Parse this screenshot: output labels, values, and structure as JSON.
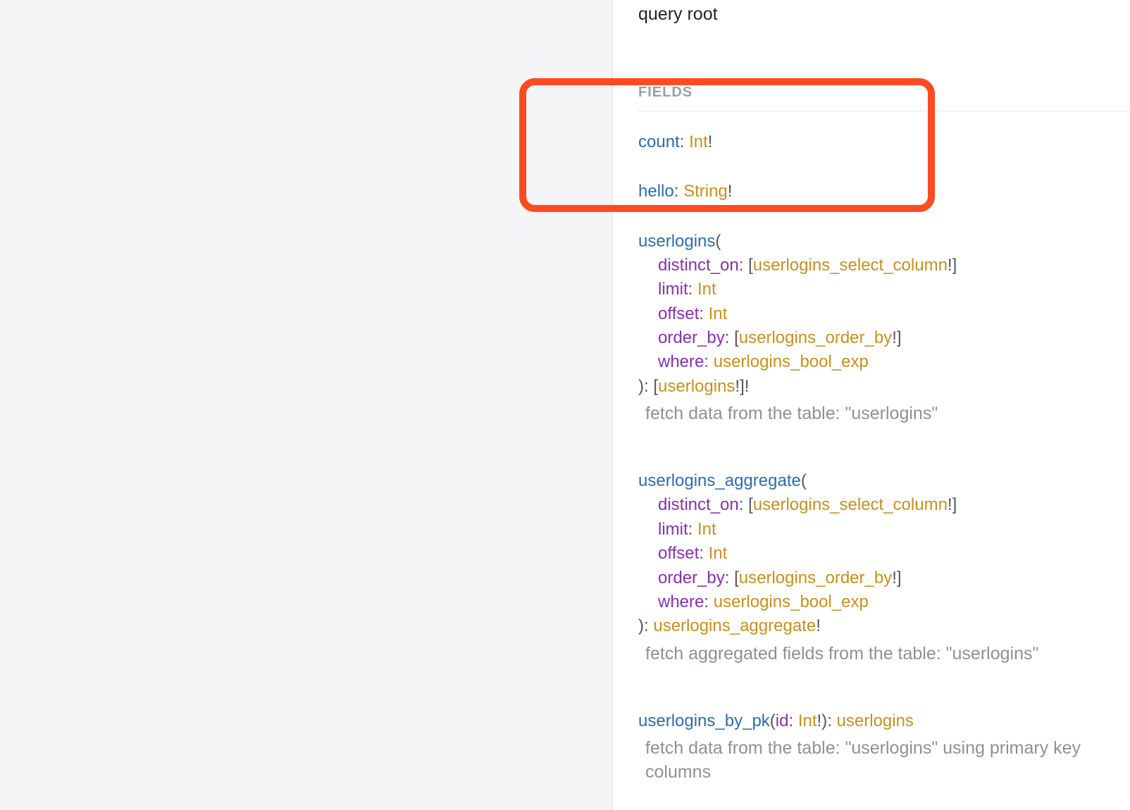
{
  "root_description": "query root",
  "fields_label": "FIELDS",
  "punct": {
    "colon": ": ",
    "open_paren": "(",
    "close_paren": ")",
    "open_bracket": "[",
    "close_bracket": "]",
    "bang": "!"
  },
  "fields": {
    "count": {
      "name": "count",
      "type": "Int"
    },
    "hello": {
      "name": "hello",
      "type": "String"
    },
    "userlogins": {
      "name": "userlogins",
      "return_type": "userlogins",
      "description": "fetch data from the table: \"userlogins\"",
      "args": {
        "distinct_on": {
          "name": "distinct_on",
          "type": "userlogins_select_column"
        },
        "limit": {
          "name": "limit",
          "type": "Int"
        },
        "offset": {
          "name": "offset",
          "type": "Int"
        },
        "order_by": {
          "name": "order_by",
          "type": "userlogins_order_by"
        },
        "where": {
          "name": "where",
          "type": "userlogins_bool_exp"
        }
      }
    },
    "userlogins_aggregate": {
      "name": "userlogins_aggregate",
      "return_type": "userlogins_aggregate",
      "description": "fetch aggregated fields from the table: \"userlogins\"",
      "args": {
        "distinct_on": {
          "name": "distinct_on",
          "type": "userlogins_select_column"
        },
        "limit": {
          "name": "limit",
          "type": "Int"
        },
        "offset": {
          "name": "offset",
          "type": "Int"
        },
        "order_by": {
          "name": "order_by",
          "type": "userlogins_order_by"
        },
        "where": {
          "name": "where",
          "type": "userlogins_bool_exp"
        }
      }
    },
    "userlogins_by_pk": {
      "name": "userlogins_by_pk",
      "return_type": "userlogins",
      "description": "fetch data from the table: \"userlogins\" using primary key columns",
      "args": {
        "id": {
          "name": "id",
          "type": "Int"
        }
      }
    }
  }
}
